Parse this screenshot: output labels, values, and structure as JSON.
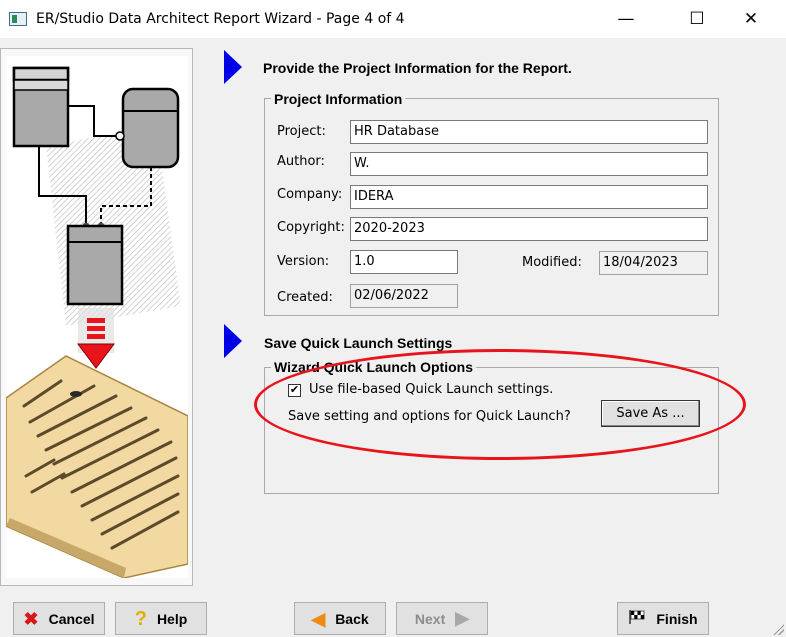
{
  "window": {
    "title": "ER/Studio Data Architect Report Wizard - Page 4 of 4",
    "minimize_glyph": "—",
    "maximize_glyph": "☐",
    "close_glyph": "✕"
  },
  "project_section": {
    "title": "Provide the Project Information for the Report.",
    "group_label": "Project Information",
    "project_label": "Project:",
    "project_value": "HR Database",
    "author_label": "Author:",
    "author_value": "W.",
    "company_label": "Company:",
    "company_value": "IDERA",
    "copyright_label": "Copyright:",
    "copyright_value": "2020-2023",
    "version_label": "Version:",
    "version_value": "1.0",
    "modified_label": "Modified:",
    "modified_value": "18/04/2023",
    "created_label": "Created:",
    "created_value": "02/06/2022"
  },
  "quick_launch": {
    "title": "Save Quick Launch Settings",
    "group_label": "Wizard Quick Launch Options",
    "checkbox_label": "Use file-based Quick Launch settings.",
    "checkbox_checked": true,
    "checkbox_mark": "✔",
    "prompt": "Save setting and options for Quick Launch?",
    "save_as_label": "Save As ..."
  },
  "buttons": {
    "cancel": "Cancel",
    "help": "Help",
    "back": "Back",
    "next": "Next",
    "finish": "Finish"
  },
  "icons": {
    "cancel": "red-x-icon",
    "help": "question-mark-icon",
    "back": "left-arrow-icon",
    "next": "right-arrow-icon",
    "finish": "checkered-flag-icon"
  },
  "colors": {
    "accent_arrow": "#0000e8",
    "highlight_ellipse": "#e8141b"
  }
}
